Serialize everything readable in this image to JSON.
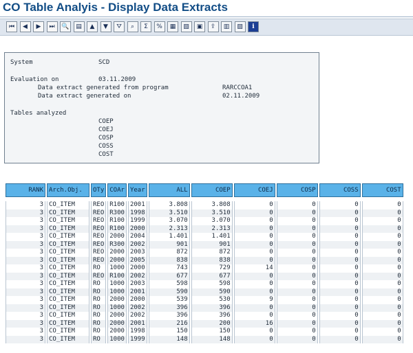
{
  "title": "CO Table Analyis - Display Data Extracts",
  "toolbar": {
    "buttons": [
      {
        "name": "first-page-icon",
        "glyph": "⏮"
      },
      {
        "name": "previous-page-icon",
        "glyph": "◀"
      },
      {
        "name": "next-page-icon",
        "glyph": "▶"
      },
      {
        "name": "last-page-icon",
        "glyph": "⏭"
      },
      {
        "name": "details-icon",
        "glyph": "🔍"
      },
      {
        "name": "print-icon",
        "glyph": "▤"
      },
      {
        "name": "sort-ascending-icon",
        "glyph": "▲"
      },
      {
        "name": "sort-descending-icon",
        "glyph": "▼"
      },
      {
        "name": "filter-icon",
        "glyph": "⛛"
      },
      {
        "name": "find-icon",
        "glyph": "⌕"
      },
      {
        "name": "sum-icon",
        "glyph": "Σ"
      },
      {
        "name": "subtotal-icon",
        "glyph": "%"
      },
      {
        "name": "change-layout-icon",
        "glyph": "▦"
      },
      {
        "name": "choose-layout-icon",
        "glyph": "▧"
      },
      {
        "name": "save-layout-icon",
        "glyph": "▣"
      },
      {
        "name": "export-icon",
        "glyph": "⇪"
      },
      {
        "name": "spreadsheet-icon",
        "glyph": "▥"
      },
      {
        "name": "word-processing-icon",
        "glyph": "▨"
      },
      {
        "name": "information-icon",
        "glyph": "i"
      }
    ]
  },
  "header": {
    "system_label": "System",
    "system_value": "SCD",
    "evaluation_label": "Evaluation on",
    "evaluation_value": "03.11.2009",
    "program_label": "Data extract generated from program",
    "program_value": "RARCCOA1",
    "generated_label": "Data extract generated on",
    "generated_value": "02.11.2009",
    "tables_label": "Tables analyzed",
    "tables": [
      "COEP",
      "COEJ",
      "COSP",
      "COSS",
      "COST"
    ]
  },
  "table": {
    "columns": [
      "RANK",
      "Arch.Obj.",
      "OTy",
      "COAr",
      "Year",
      "ALL",
      "COEP",
      "COEJ",
      "COSP",
      "COSS",
      "COST"
    ],
    "rows": [
      [
        "3",
        "CO_ITEM",
        "REO",
        "R100",
        "2001",
        "3.808",
        "3.808",
        "0",
        "0",
        "0",
        "0"
      ],
      [
        "3",
        "CO_ITEM",
        "REO",
        "R300",
        "1998",
        "3.510",
        "3.510",
        "0",
        "0",
        "0",
        "0"
      ],
      [
        "3",
        "CO_ITEM",
        "REO",
        "R100",
        "1999",
        "3.070",
        "3.070",
        "0",
        "0",
        "0",
        "0"
      ],
      [
        "3",
        "CO_ITEM",
        "REO",
        "R100",
        "2000",
        "2.313",
        "2.313",
        "0",
        "0",
        "0",
        "0"
      ],
      [
        "3",
        "CO_ITEM",
        "REO",
        "2000",
        "2004",
        "1.401",
        "1.401",
        "0",
        "0",
        "0",
        "0"
      ],
      [
        "3",
        "CO_ITEM",
        "REO",
        "R300",
        "2002",
        "901",
        "901",
        "0",
        "0",
        "0",
        "0"
      ],
      [
        "3",
        "CO_ITEM",
        "REO",
        "2000",
        "2003",
        "872",
        "872",
        "0",
        "0",
        "0",
        "0"
      ],
      [
        "3",
        "CO_ITEM",
        "REO",
        "2000",
        "2005",
        "838",
        "838",
        "0",
        "0",
        "0",
        "0"
      ],
      [
        "3",
        "CO_ITEM",
        "RO",
        "1000",
        "2000",
        "743",
        "729",
        "14",
        "0",
        "0",
        "0"
      ],
      [
        "3",
        "CO_ITEM",
        "REO",
        "R100",
        "2002",
        "677",
        "677",
        "0",
        "0",
        "0",
        "0"
      ],
      [
        "3",
        "CO_ITEM",
        "RO",
        "1000",
        "2003",
        "598",
        "598",
        "0",
        "0",
        "0",
        "0"
      ],
      [
        "3",
        "CO_ITEM",
        "RO",
        "1000",
        "2001",
        "590",
        "590",
        "0",
        "0",
        "0",
        "0"
      ],
      [
        "3",
        "CO_ITEM",
        "RO",
        "2000",
        "2000",
        "539",
        "530",
        "9",
        "0",
        "0",
        "0"
      ],
      [
        "3",
        "CO_ITEM",
        "RO",
        "1000",
        "2002",
        "396",
        "396",
        "0",
        "0",
        "0",
        "0"
      ],
      [
        "3",
        "CO_ITEM",
        "RO",
        "2000",
        "2002",
        "396",
        "396",
        "0",
        "0",
        "0",
        "0"
      ],
      [
        "3",
        "CO_ITEM",
        "RO",
        "2000",
        "2001",
        "216",
        "200",
        "16",
        "0",
        "0",
        "0"
      ],
      [
        "3",
        "CO_ITEM",
        "RO",
        "2000",
        "1998",
        "150",
        "150",
        "0",
        "0",
        "0",
        "0"
      ],
      [
        "3",
        "CO_ITEM",
        "RO",
        "1000",
        "1999",
        "148",
        "148",
        "0",
        "0",
        "0",
        "0"
      ]
    ]
  }
}
